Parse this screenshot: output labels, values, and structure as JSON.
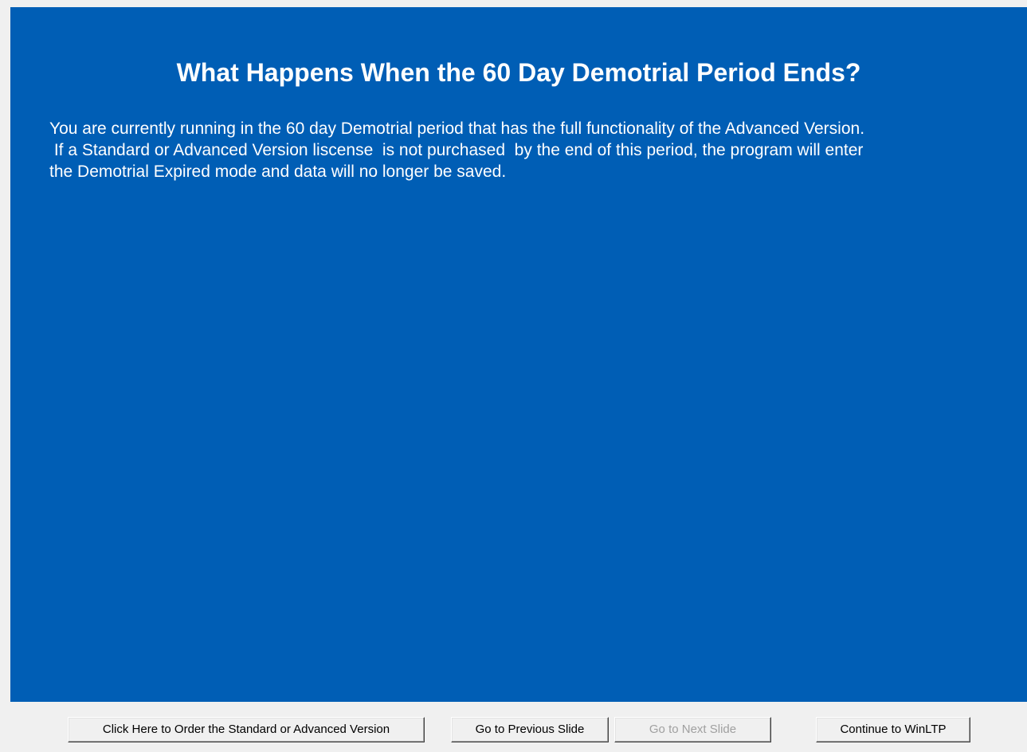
{
  "slide": {
    "title": "What Happens When the 60 Day Demotrial Period Ends?",
    "body_lines": [
      "You are currently running in the 60 day Demotrial period that has the full functionality of the Advanced Version.",
      " If a Standard or Advanced Version liscense  is not purchased  by the end of this period, the program will enter",
      "the Demotrial Expired mode and data will no longer be saved."
    ]
  },
  "buttons": {
    "order_label": "Click Here to Order the Standard or Advanced Version",
    "previous_label": "Go to Previous Slide",
    "next_label": "Go to Next Slide",
    "next_enabled": false,
    "continue_label": "Continue to WinLTP"
  },
  "colors": {
    "slide_background": "#005eb5",
    "slide_text": "#ffffff",
    "window_background": "#f0f0f0",
    "disabled_text": "#a0a0a0"
  }
}
